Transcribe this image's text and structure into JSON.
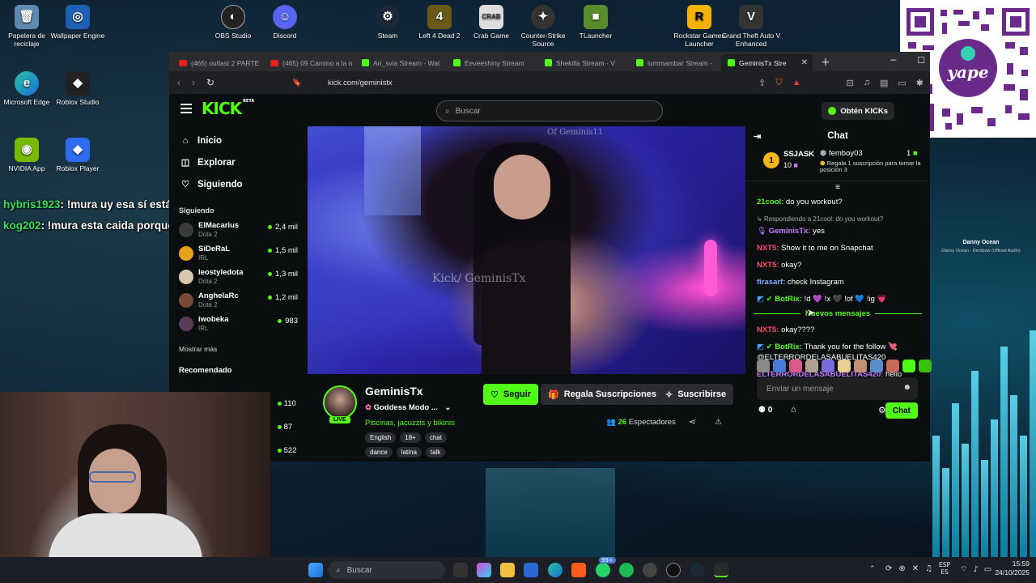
{
  "desktop": {
    "icons": [
      {
        "label": "Papelera de reciclaje"
      },
      {
        "label": "Wallpaper Engine"
      },
      {
        "label": "Microsoft Edge"
      },
      {
        "label": "Roblox Studio"
      },
      {
        "label": "NVIDIA App"
      },
      {
        "label": "Roblox Player"
      },
      {
        "label": "OBS Studio"
      },
      {
        "label": "Discord"
      },
      {
        "label": "Steam"
      },
      {
        "label": "Left 4 Dead 2"
      },
      {
        "label": "Crab Game"
      },
      {
        "label": "Counter-Strike Source"
      },
      {
        "label": "TLauncher"
      },
      {
        "label": "Rockstar Games Launcher"
      },
      {
        "label": "Grand Theft Auto V Enhanced"
      }
    ],
    "overlay_chat": [
      {
        "user": "hybris1923",
        "text": ": !mura uy esa sí está ria"
      },
      {
        "user": "kog202",
        "text": ": !mura esta caida porque ya esa madre pspendeja"
      }
    ],
    "media": {
      "title": "Danny Ocean",
      "subtitle": "Danny Ocean - Dembow (Official Audio)"
    },
    "qr_brand": "yape"
  },
  "browser": {
    "tabs": [
      {
        "label": "(465) outlast 2 PARTE",
        "type": "yt"
      },
      {
        "label": "(465) 09 Camino a la n",
        "type": "yt"
      },
      {
        "label": "Ari_svia Stream - Wat",
        "type": "kick"
      },
      {
        "label": "Eeveeshiny Stream",
        "type": "kick"
      },
      {
        "label": "Shekilla Stream - V",
        "type": "kick"
      },
      {
        "label": "lummambar Stream -",
        "type": "kick"
      },
      {
        "label": "GeminisTx Stre",
        "type": "kick",
        "active": true
      }
    ],
    "url": "kick.com/geministx"
  },
  "kick": {
    "logo": "KICK",
    "logo_beta": "BETA",
    "search_placeholder": "Buscar",
    "get_kicks": "Obtén KICKs",
    "nav": [
      {
        "label": "Inicio",
        "icon": "home-icon"
      },
      {
        "label": "Explorar",
        "icon": "compass-icon"
      },
      {
        "label": "Siguiendo",
        "icon": "heart-icon"
      }
    ],
    "following_title": "Siguiendo",
    "following": [
      {
        "name": "ElMacarius",
        "category": "Dota 2",
        "viewers": "2,4 mil"
      },
      {
        "name": "SiDeRaL",
        "category": "IRL",
        "viewers": "1,5 mil"
      },
      {
        "name": "leostyledota",
        "category": "Dota 2",
        "viewers": "1,3 mil"
      },
      {
        "name": "AnghelaRc",
        "category": "Dota 2",
        "viewers": "1,2 mil"
      },
      {
        "name": "iwobeka",
        "category": "IRL",
        "viewers": "983"
      }
    ],
    "show_more": "Mostrar más",
    "recommended_title": "Recomendado",
    "recommended_viewers": [
      "110",
      "87",
      "522"
    ],
    "watermarks": {
      "top": "Of Geminis11",
      "middle": "Kick/ GeminisTx"
    },
    "channel": {
      "name": "GeminisTx",
      "live": "LIVE",
      "title": "Goddess Modo ...",
      "category": "Piscinas, jacuzzis y bikinis",
      "tags": [
        "English",
        "18+",
        "chat",
        "dance",
        "latina",
        "talk"
      ],
      "follow": "Seguir",
      "gift_subs": "Regala Suscripciones",
      "subscribe": "Suscribirse",
      "viewers_count": "26",
      "viewers_label": "Espectadores"
    },
    "chat": {
      "title": "Chat",
      "leader": {
        "rank": "1",
        "name": "SSJASK",
        "count": "10"
      },
      "gift": {
        "name": "femboy03",
        "count": "1",
        "text": "Regala 1 suscripción para tomar la posición 3"
      },
      "messages": [
        {
          "user": "21cool:",
          "text": " do you workout?",
          "color": "#53fc18"
        },
        {
          "reply": "Respondiendo a 21cool: do you workout?"
        },
        {
          "user": "GeminisTx:",
          "text": " yes",
          "color": "#c77dff"
        },
        {
          "user": "NXT5:",
          "text": " Show it to me on Snapchat",
          "color": "#ff4d6d"
        },
        {
          "user": "NXT5:",
          "text": " okay?",
          "color": "#ff4d6d"
        },
        {
          "user": "firasarf:",
          "text": " check Instagram",
          "color": "#7fb2ff"
        },
        {
          "user": "BotRix:",
          "text": " !d 💜 !x 🖤 !of 💙 !ig 💗",
          "color": "#53fc18"
        }
      ],
      "new_messages": "Nuevos mensajes",
      "messages2": [
        {
          "user": "NXT5:",
          "text": " okay????",
          "color": "#ff4d6d"
        },
        {
          "user": "BotRix:",
          "text": " Thank you for the follow 💘 @ELTERRORDELASABUELITAS420",
          "color": "#53fc18"
        },
        {
          "user": "ELTERRORDELASABUELITAS420:",
          "text": " hello",
          "color": "#c77dff"
        }
      ],
      "input_placeholder": "Enviar un mensaje",
      "kicks": "0",
      "send": "Chat"
    }
  },
  "taskbar": {
    "search": "Buscar",
    "badge": "99+",
    "lang": "ESP",
    "lang2": "ES",
    "time": "15:59",
    "date": "24/10/2025"
  }
}
